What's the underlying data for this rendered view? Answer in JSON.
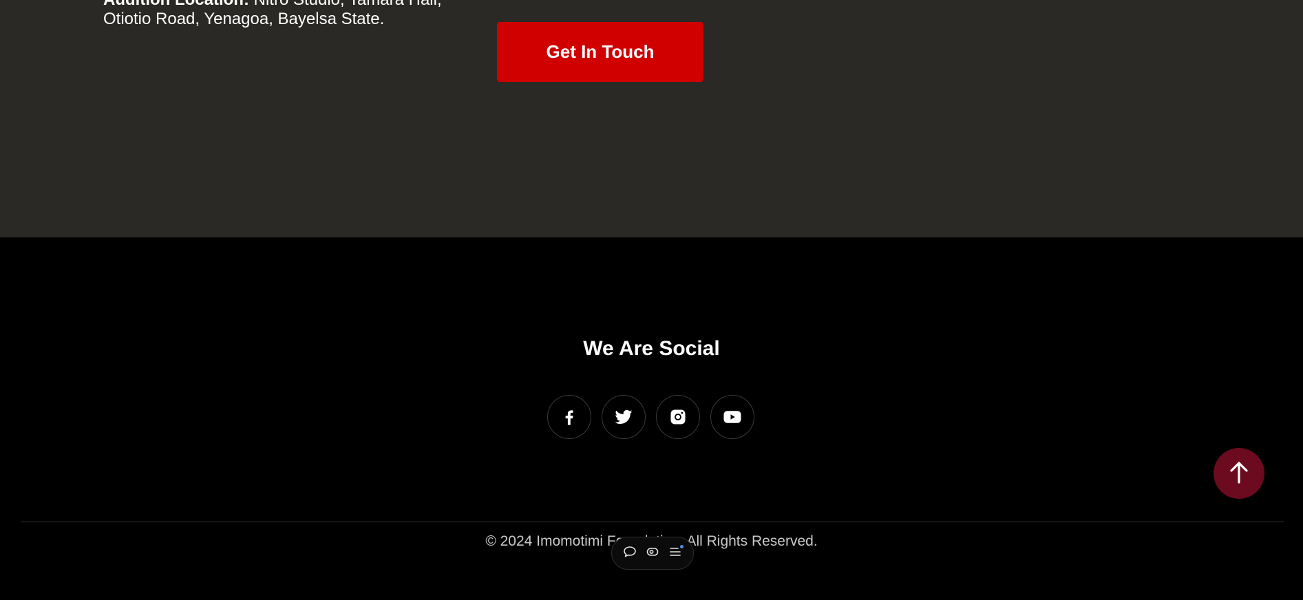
{
  "upper": {
    "location_label": "Audition Location:",
    "location_text": "Nitro Studio, Tamara Hall, Otiotio Road, Yenagoa, Bayelsa State.",
    "cta_label": "Get In Touch",
    "background": "#2a2925",
    "accent": "#d10000"
  },
  "footer": {
    "social_heading": "We Are Social",
    "social_links": [
      {
        "icon": "facebook-icon"
      },
      {
        "icon": "twitter-icon"
      },
      {
        "icon": "instagram-icon"
      },
      {
        "icon": "youtube-icon"
      }
    ],
    "copyright": "© 2024 Imomotimi Foundation. All Rights Reserved.",
    "back_to_top_icon": "arrow-up-icon",
    "back_to_top_color": "#6c0a1f"
  },
  "toolbar": {
    "items": [
      {
        "icon": "comment-icon"
      },
      {
        "icon": "eye-icon"
      },
      {
        "icon": "menu-icon"
      }
    ]
  }
}
